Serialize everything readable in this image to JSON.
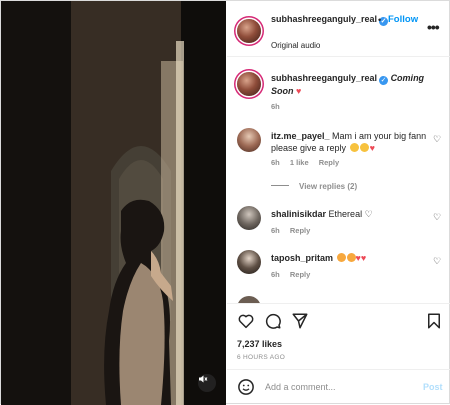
{
  "header": {
    "username": "subhashreeganguly_real",
    "separator": "•",
    "follow_label": "Follow",
    "audio_label": "Original audio",
    "more_label": "•••"
  },
  "caption": {
    "username": "subhashreeganguly_real",
    "text": "Coming Soon",
    "time": "6h"
  },
  "comments": [
    {
      "username": "itz.me_payel_",
      "text": "Mam i am your big fann please give a reply",
      "time": "6h",
      "likes": "1 like",
      "reply_label": "Reply",
      "view_replies": "View replies (2)"
    },
    {
      "username": "shalinisikdar",
      "text": "Ethereal",
      "time": "6h",
      "reply_label": "Reply"
    },
    {
      "username": "taposh_pritam",
      "text": "",
      "time": "6h",
      "reply_label": "Reply"
    }
  ],
  "actions": {
    "likes": "7,237 likes",
    "time": "6 HOURS AGO"
  },
  "add_comment": {
    "placeholder": "Add a comment...",
    "post_label": "Post"
  },
  "colors": {
    "follow": "#0095f6",
    "verified": "#3897f0",
    "heart_red": "#ed4956",
    "post_disabled": "#b2dffc"
  }
}
